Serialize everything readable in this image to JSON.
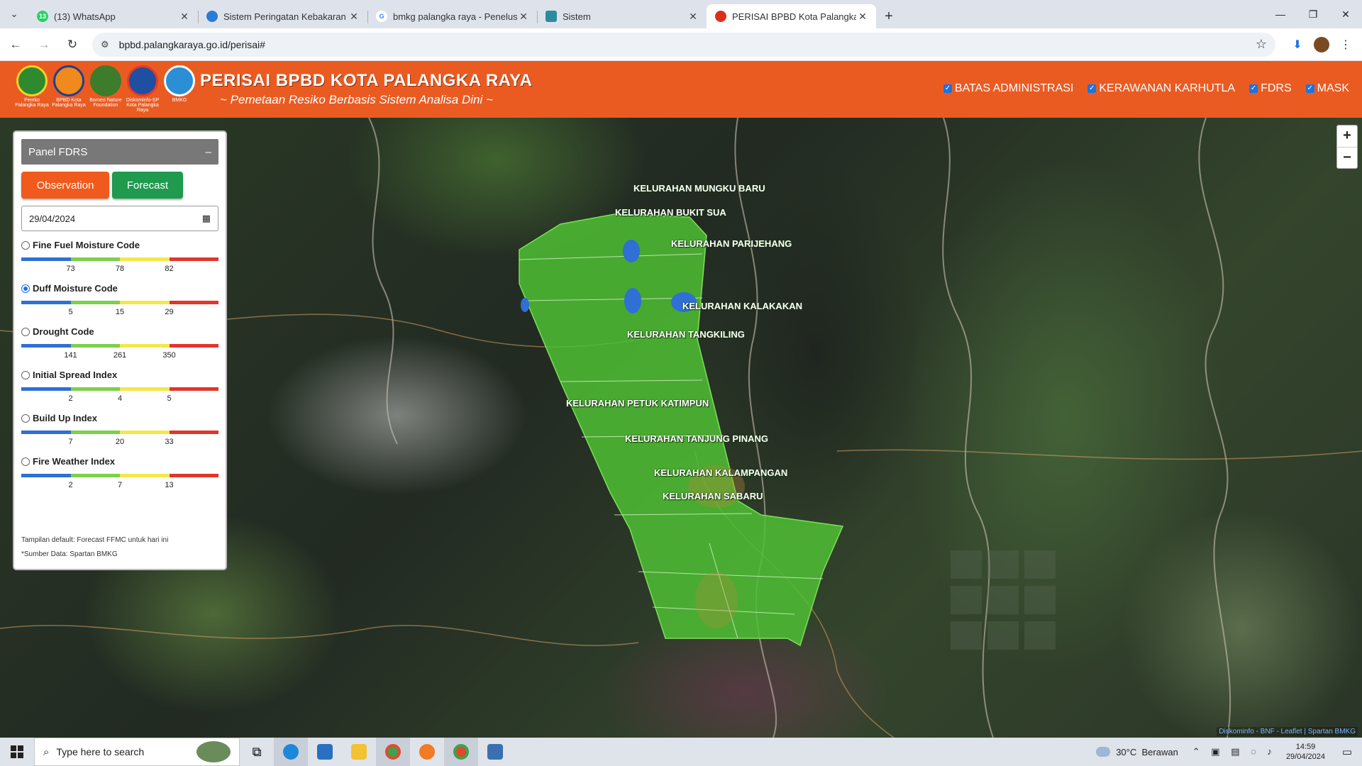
{
  "browser": {
    "tabs": [
      {
        "title": "(13) WhatsApp",
        "icon": "whatsapp-icon",
        "color": "#25d366",
        "badge": "13"
      },
      {
        "title": "Sistem Peringatan Kebakaran H",
        "icon": "site-icon",
        "color": "#2b7bd8",
        "badge": ""
      },
      {
        "title": "bmkg palangka raya - Penelusu",
        "icon": "google-icon",
        "color": "#4285f4",
        "badge": "G"
      },
      {
        "title": "Sistem",
        "icon": "site-icon",
        "color": "#2a8c9c",
        "badge": ""
      },
      {
        "title": "PERISAI BPBD Kota Palangka Ra",
        "icon": "bpbd-icon",
        "color": "#d9301c",
        "badge": ""
      }
    ],
    "url": "bpbd.palangkaraya.go.id/perisai#"
  },
  "header": {
    "logos": [
      {
        "caption": "Pemko Palangka Raya",
        "color": "#2f8a2f"
      },
      {
        "caption": "BPBD Kota Palangka Raya",
        "color": "#f08a1c"
      },
      {
        "caption": "Borneo Nature Foundation",
        "color": "#3c7c2a"
      },
      {
        "caption": "Diskominfo-SP Kota Palangka Raya",
        "color": "#1e4fa0"
      },
      {
        "caption": "BMKG",
        "color": "#2a8fd4"
      }
    ],
    "title": "PERISAI BPBD KOTA PALANGKA RAYA",
    "subtitle": "~ Pemetaan Resiko Berbasis Sistem Analisa Dini ~",
    "layers": [
      {
        "label": "BATAS ADMINISTRASI",
        "checked": true
      },
      {
        "label": "KERAWANAN KARHUTLA",
        "checked": true
      },
      {
        "label": "FDRS",
        "checked": true
      },
      {
        "label": "MASK",
        "checked": true
      }
    ]
  },
  "panel": {
    "title": "Panel FDRS",
    "collapse": "–",
    "observation_label": "Observation",
    "forecast_label": "Forecast",
    "date_value": "29/04/2024",
    "scale_colors": [
      "#2f6fd6",
      "#7cd04a",
      "#f2e84a",
      "#e0362c"
    ],
    "indices": [
      {
        "name": "Fine Fuel Moisture Code",
        "selected": false,
        "ticks": [
          "73",
          "78",
          "82"
        ]
      },
      {
        "name": "Duff Moisture Code",
        "selected": true,
        "ticks": [
          "5",
          "15",
          "29"
        ]
      },
      {
        "name": "Drought Code",
        "selected": false,
        "ticks": [
          "141",
          "261",
          "350"
        ]
      },
      {
        "name": "Initial Spread Index",
        "selected": false,
        "ticks": [
          "2",
          "4",
          "5"
        ]
      },
      {
        "name": "Build Up Index",
        "selected": false,
        "ticks": [
          "7",
          "20",
          "33"
        ]
      },
      {
        "name": "Fire Weather Index",
        "selected": false,
        "ticks": [
          "2",
          "7",
          "13"
        ]
      }
    ],
    "note_default": "Tampilan default: Forecast FFMC untuk hari ini",
    "note_source": "*Sumber Data: Spartan BMKG"
  },
  "map": {
    "region_color": "#4fc034",
    "labels": [
      "KELURAHAN MUNGKU BARU",
      "KELURAHAN BUKIT SUA",
      "KELURAHAN PARIJEHANG",
      "KELURAHAN KALAKAKAN",
      "KELURAHAN TANGKILING",
      "KELURAHAN PETUK KATIMPUN",
      "KELURAHAN TANJUNG PINANG",
      "KELURAHAN KALAMPANGAN",
      "KELURAHAN SABARU"
    ],
    "zoom_in": "+",
    "zoom_out": "−",
    "attribution": "Diskominfo - BNF - Leaflet | Spartan BMKG"
  },
  "taskbar": {
    "search_placeholder": "Type here to search",
    "weather_temp": "30°C",
    "weather_desc": "Berawan",
    "time": "14:59",
    "date": "29/04/2024"
  }
}
